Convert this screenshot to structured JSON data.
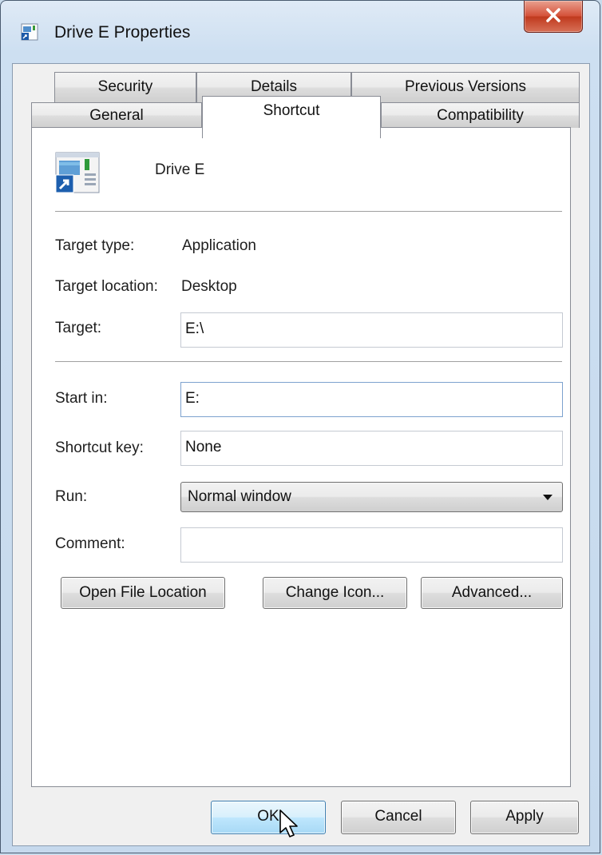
{
  "window": {
    "title": "Drive E Properties"
  },
  "tabs_back": [
    {
      "label": "Security"
    },
    {
      "label": "Details"
    },
    {
      "label": "Previous Versions"
    }
  ],
  "tabs_front": [
    {
      "label": "General"
    },
    {
      "label": "Shortcut",
      "active": true
    },
    {
      "label": "Compatibility"
    }
  ],
  "shortcut": {
    "name": "Drive E",
    "target_type_label": "Target type:",
    "target_type_value": "Application",
    "target_location_label": "Target location:",
    "target_location_value": "Desktop",
    "target_label": "Target:",
    "target_value": "E:\\",
    "start_in_label": "Start in:",
    "start_in_value": "E:",
    "shortcut_key_label": "Shortcut key:",
    "shortcut_key_value": "None",
    "run_label": "Run:",
    "run_value": "Normal window",
    "comment_label": "Comment:",
    "comment_value": ""
  },
  "actions": {
    "open_file_location": "Open File Location",
    "change_icon": "Change Icon...",
    "advanced": "Advanced..."
  },
  "footer": {
    "ok": "OK",
    "cancel": "Cancel",
    "apply": "Apply"
  },
  "icons": [
    "shortcut-app-icon",
    "close-icon",
    "dropdown-arrow-icon",
    "mouse-pointer-icon"
  ],
  "colors": {
    "default_button_border": "#3c7fb1",
    "close_button": "#c03a1e",
    "focus_border": "#7da2ce"
  }
}
